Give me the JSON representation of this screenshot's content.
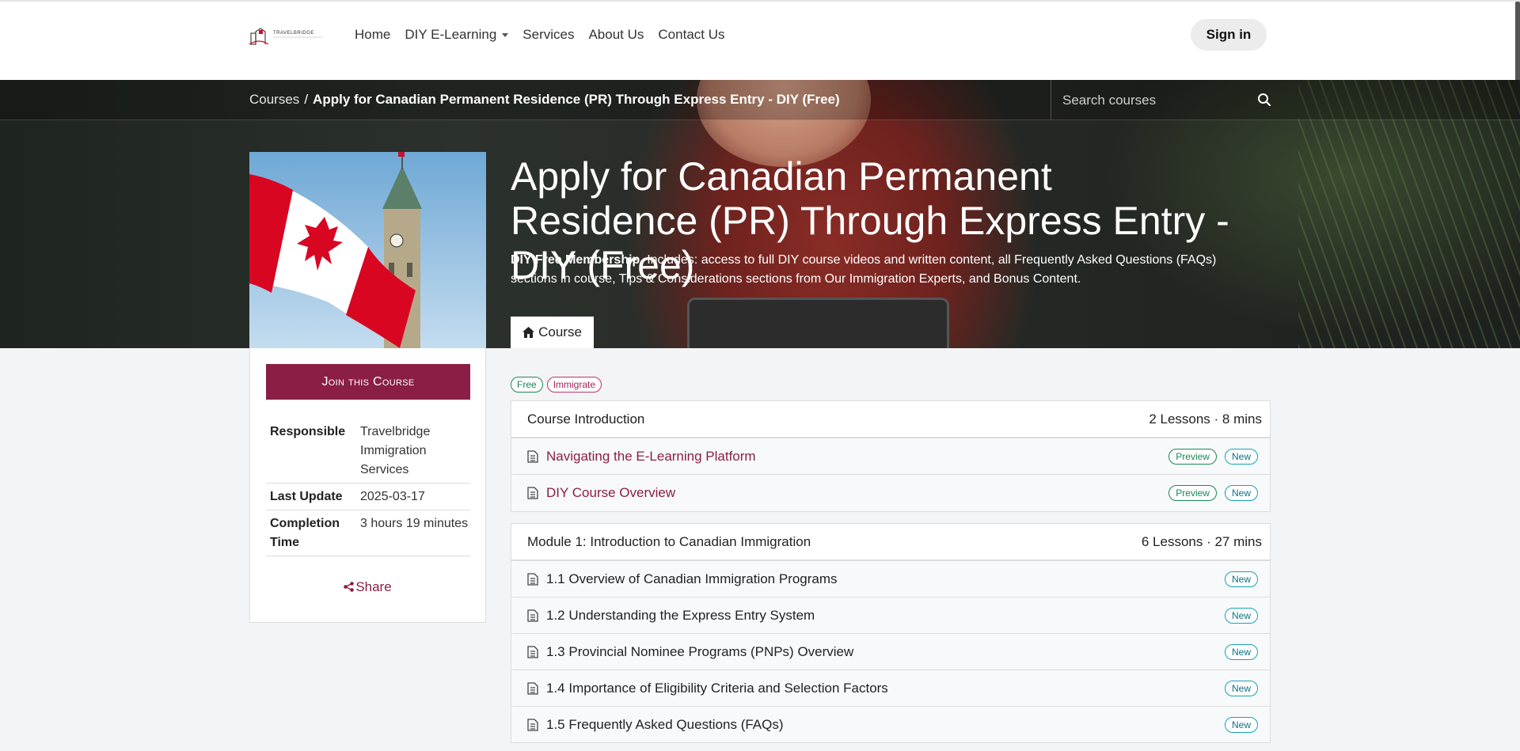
{
  "nav": {
    "logo_text": "TRAVELBRIDGE",
    "links": [
      "Home",
      "DIY E-Learning",
      "Services",
      "About Us",
      "Contact Us"
    ],
    "signin": "Sign in"
  },
  "breadcrumb": {
    "root": "Courses",
    "separator": "/",
    "current": "Apply for Canadian Permanent Residence (PR) Through Express Entry - DIY (Free)"
  },
  "search": {
    "placeholder": "Search courses"
  },
  "hero": {
    "title": "Apply for Canadian Permanent Residence (PR) Through Express Entry - DIY (Free)",
    "desc_bold": "DIY Free Membership.",
    "desc": " Includes: access to full DIY course videos and written content, all Frequently Asked Questions (FAQs) sections in course, Tips & Considerations sections from Our Immigration Experts, and Bonus Content.",
    "tab": "Course"
  },
  "sidebar": {
    "join": "Join this Course",
    "info": [
      {
        "label": "Responsible",
        "value": "Travelbridge Immigration Services"
      },
      {
        "label": "Last Update",
        "value": "2025-03-17"
      },
      {
        "label": "Completion Time",
        "value": "3 hours 19 minutes"
      }
    ],
    "share": "Share"
  },
  "tags": [
    "Free",
    "Immigrate"
  ],
  "sections": [
    {
      "title": "Course Introduction",
      "meta": "2 Lessons · 8 mins",
      "lessons": [
        {
          "title": "Navigating the E-Learning Platform",
          "preview": "Preview",
          "new": "New"
        },
        {
          "title": "DIY Course Overview",
          "preview": "Preview",
          "new": "New"
        }
      ]
    },
    {
      "title": "Module 1: Introduction to Canadian Immigration",
      "meta": "6 Lessons · 27 mins",
      "lessons": [
        {
          "title": "1.1 Overview of Canadian Immigration Programs",
          "new": "New"
        },
        {
          "title": "1.2 Understanding the Express Entry System",
          "new": "New"
        },
        {
          "title": "1.3 Provincial Nominee Programs (PNPs) Overview",
          "new": "New"
        },
        {
          "title": "1.4 Importance of Eligibility Criteria and Selection Factors",
          "new": "New"
        },
        {
          "title": "1.5 Frequently Asked Questions (FAQs)",
          "new": "New"
        }
      ]
    }
  ],
  "colors": {
    "brand": "#8a1e45",
    "preview": "#198754",
    "new": "#17a2b8"
  }
}
